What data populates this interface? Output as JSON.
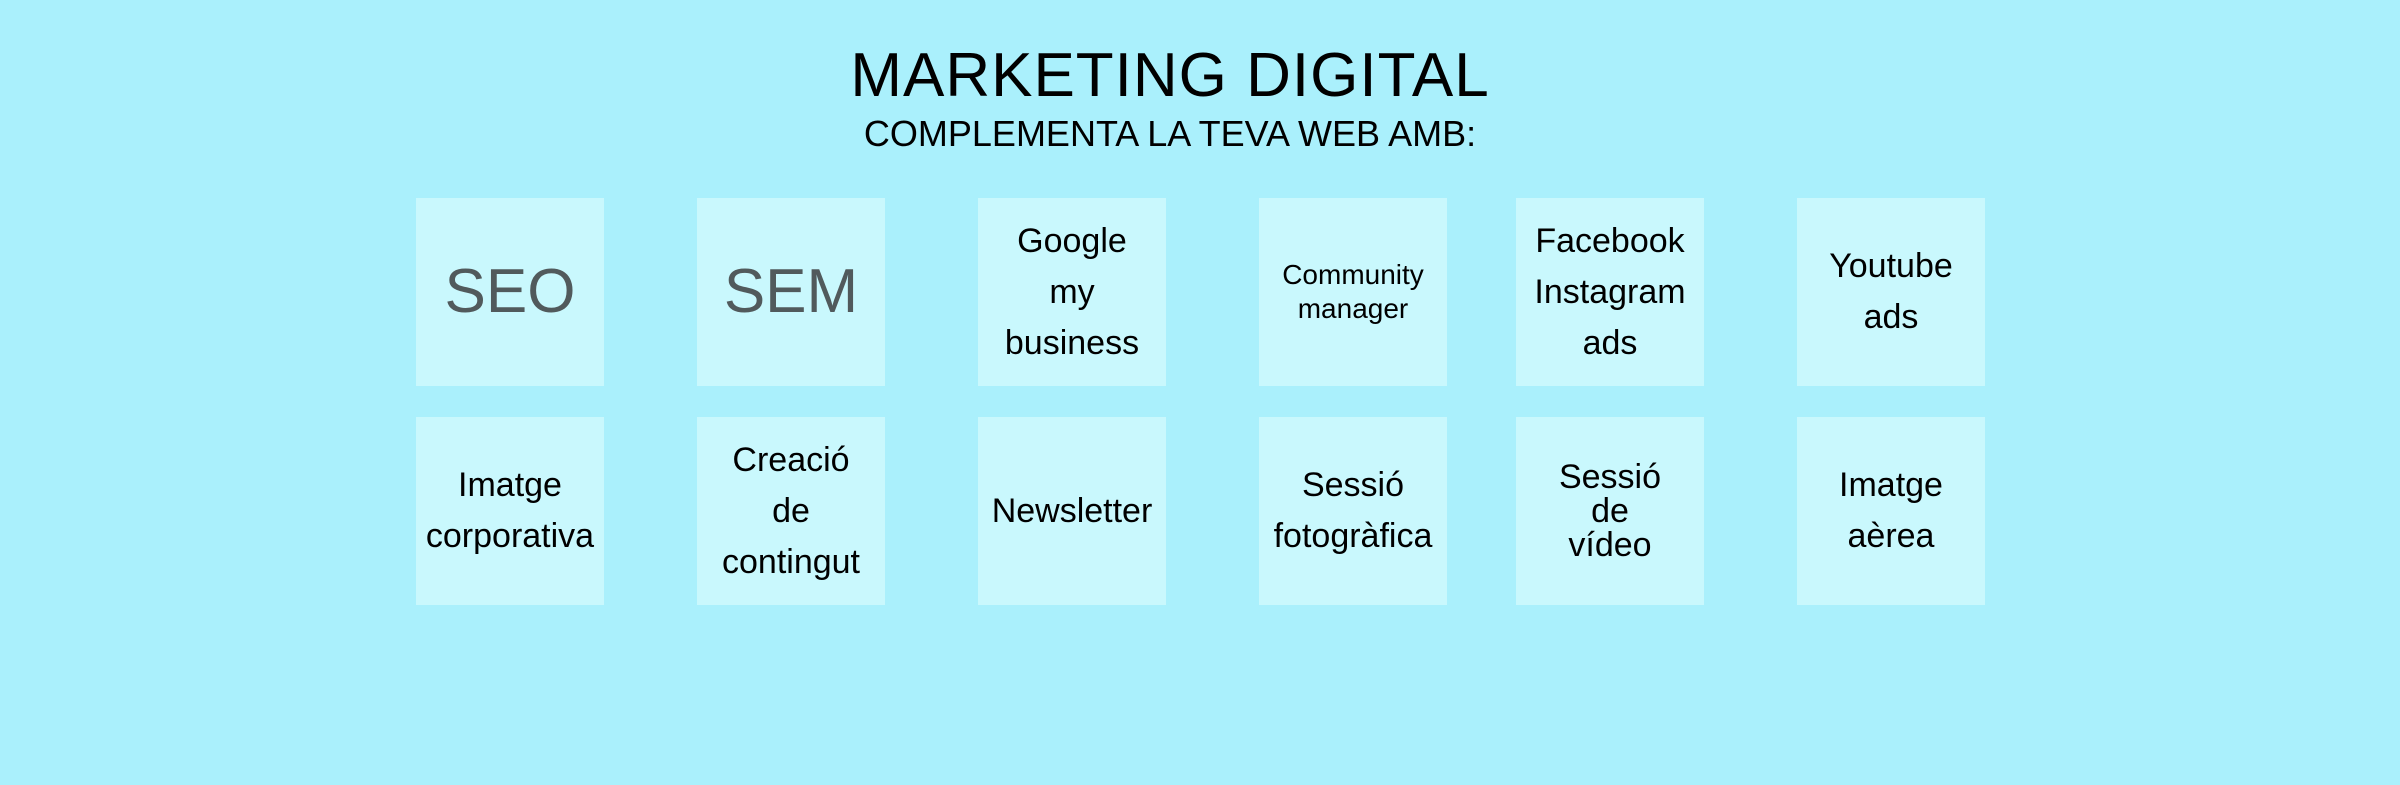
{
  "header": {
    "title": "MARKETING DIGITAL",
    "subtitle": "COMPLEMENTA LA TEVA WEB AMB:"
  },
  "services": [
    {
      "label": "SEO"
    },
    {
      "label": "SEM"
    },
    {
      "label": "Google\nmy\nbusiness"
    },
    {
      "label": "Community\nmanager"
    },
    {
      "label": "Facebook\nInstagram\nads"
    },
    {
      "label": "Youtube\nads"
    },
    {
      "label": "Imatge\ncorporativa"
    },
    {
      "label": "Creació\nde\ncontingut"
    },
    {
      "label": "Newsletter"
    },
    {
      "label": "Sessió\nfotogràfica"
    },
    {
      "label": "Sessió\nde\nvídeo"
    },
    {
      "label": "Imatge\naèrea"
    }
  ],
  "colors": {
    "background": "#aaf0fc",
    "tile": "#c9f8fd",
    "large_text": "#515a5c"
  }
}
